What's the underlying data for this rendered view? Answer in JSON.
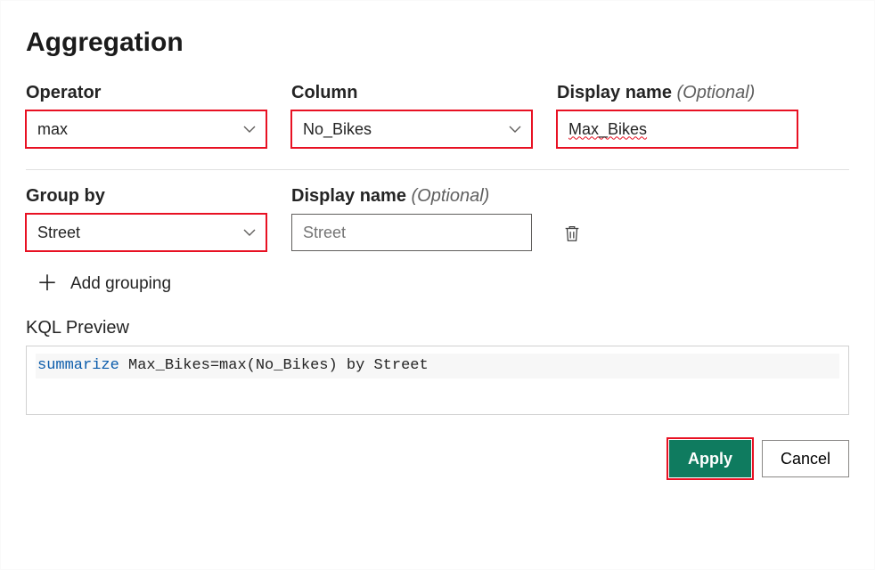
{
  "title": "Aggregation",
  "operator": {
    "label": "Operator",
    "value": "max"
  },
  "column": {
    "label": "Column",
    "value": "No_Bikes"
  },
  "displayName": {
    "label": "Display name",
    "optional": "(Optional)",
    "value": "Max_Bikes"
  },
  "groupBy": {
    "label": "Group by",
    "value": "Street"
  },
  "groupDisplayName": {
    "label": "Display name",
    "optional": "(Optional)",
    "placeholder": "Street",
    "value": ""
  },
  "addGrouping": "Add grouping",
  "preview": {
    "label": "KQL Preview",
    "keyword": "summarize",
    "rest": " Max_Bikes=max(No_Bikes) by Street"
  },
  "buttons": {
    "apply": "Apply",
    "cancel": "Cancel"
  }
}
